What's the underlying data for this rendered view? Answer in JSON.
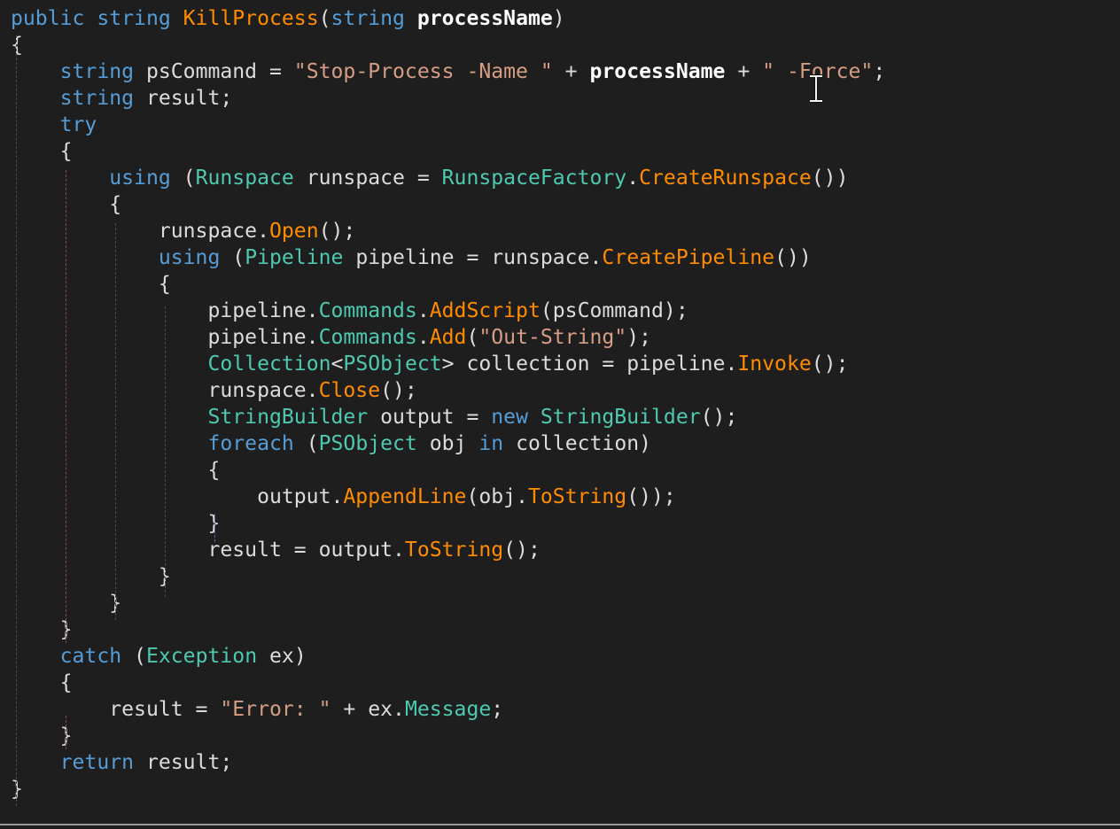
{
  "editor": {
    "language": "C#",
    "colors": {
      "background": "#1e1e1e",
      "keyword": "#569cd6",
      "type": "#4ec9b0",
      "method": "#ff8c00",
      "string": "#d69d85",
      "plain": "#dcdcdc"
    },
    "cursor_icon": "text-ibeam-cursor",
    "lines": [
      [
        [
          "kw",
          "public"
        ],
        [
          "pl",
          " "
        ],
        [
          "kw",
          "string"
        ],
        [
          "pl",
          " "
        ],
        [
          "fn",
          "KillProcess"
        ],
        [
          "pl",
          "("
        ],
        [
          "kw",
          "string"
        ],
        [
          "pl",
          " "
        ],
        [
          "bd",
          "processName"
        ],
        [
          "pl",
          ")"
        ]
      ],
      [
        [
          "pl",
          "{"
        ]
      ],
      [
        [
          "pl",
          "    "
        ],
        [
          "kw",
          "string"
        ],
        [
          "pl",
          " psCommand = "
        ],
        [
          "st",
          "\"Stop-Process -Name \""
        ],
        [
          "pl",
          " + "
        ],
        [
          "bd",
          "processName"
        ],
        [
          "pl",
          " + "
        ],
        [
          "st",
          "\" -Force\""
        ],
        [
          "pl",
          ";"
        ]
      ],
      [
        [
          "pl",
          "    "
        ],
        [
          "kw",
          "string"
        ],
        [
          "pl",
          " result;"
        ]
      ],
      [
        [
          "pl",
          "    "
        ],
        [
          "kw",
          "try"
        ]
      ],
      [
        [
          "pl",
          "    {"
        ]
      ],
      [
        [
          "pl",
          "        "
        ],
        [
          "kw",
          "using"
        ],
        [
          "pl",
          " ("
        ],
        [
          "ty",
          "Runspace"
        ],
        [
          "pl",
          " runspace = "
        ],
        [
          "ty",
          "RunspaceFactory"
        ],
        [
          "pl",
          "."
        ],
        [
          "fn",
          "CreateRunspace"
        ],
        [
          "pl",
          "())"
        ]
      ],
      [
        [
          "pl",
          "        {"
        ]
      ],
      [
        [
          "pl",
          "            runspace."
        ],
        [
          "fn",
          "Open"
        ],
        [
          "pl",
          "();"
        ]
      ],
      [
        [
          "pl",
          "            "
        ],
        [
          "kw",
          "using"
        ],
        [
          "pl",
          " ("
        ],
        [
          "ty",
          "Pipeline"
        ],
        [
          "pl",
          " pipeline = runspace."
        ],
        [
          "fn",
          "CreatePipeline"
        ],
        [
          "pl",
          "())"
        ]
      ],
      [
        [
          "pl",
          "            {"
        ]
      ],
      [
        [
          "pl",
          "                pipeline."
        ],
        [
          "ty",
          "Commands"
        ],
        [
          "pl",
          "."
        ],
        [
          "fn",
          "AddScript"
        ],
        [
          "pl",
          "(psCommand);"
        ]
      ],
      [
        [
          "pl",
          "                pipeline."
        ],
        [
          "ty",
          "Commands"
        ],
        [
          "pl",
          "."
        ],
        [
          "fn",
          "Add"
        ],
        [
          "pl",
          "("
        ],
        [
          "st",
          "\"Out-String\""
        ],
        [
          "pl",
          ");"
        ]
      ],
      [
        [
          "pl",
          "                "
        ],
        [
          "ty",
          "Collection"
        ],
        [
          "pl",
          "<"
        ],
        [
          "ty",
          "PSObject"
        ],
        [
          "pl",
          "> collection = pipeline."
        ],
        [
          "fn",
          "Invoke"
        ],
        [
          "pl",
          "();"
        ]
      ],
      [
        [
          "pl",
          "                runspace."
        ],
        [
          "fn",
          "Close"
        ],
        [
          "pl",
          "();"
        ]
      ],
      [
        [
          "pl",
          "                "
        ],
        [
          "ty",
          "StringBuilder"
        ],
        [
          "pl",
          " output = "
        ],
        [
          "kw",
          "new"
        ],
        [
          "pl",
          " "
        ],
        [
          "ty",
          "StringBuilder"
        ],
        [
          "pl",
          "();"
        ]
      ],
      [
        [
          "pl",
          "                "
        ],
        [
          "kw",
          "foreach"
        ],
        [
          "pl",
          " ("
        ],
        [
          "ty",
          "PSObject"
        ],
        [
          "pl",
          " obj "
        ],
        [
          "kw",
          "in"
        ],
        [
          "pl",
          " collection)"
        ]
      ],
      [
        [
          "pl",
          "                {"
        ]
      ],
      [
        [
          "pl",
          "                    output."
        ],
        [
          "fn",
          "AppendLine"
        ],
        [
          "pl",
          "(obj."
        ],
        [
          "fn",
          "ToString"
        ],
        [
          "pl",
          "());"
        ]
      ],
      [
        [
          "pl",
          "                }"
        ]
      ],
      [
        [
          "pl",
          "                result = output."
        ],
        [
          "fn",
          "ToString"
        ],
        [
          "pl",
          "();"
        ]
      ],
      [
        [
          "pl",
          "            }"
        ]
      ],
      [
        [
          "pl",
          "        }"
        ]
      ],
      [
        [
          "pl",
          "    }"
        ]
      ],
      [
        [
          "pl",
          "    "
        ],
        [
          "kw",
          "catch"
        ],
        [
          "pl",
          " ("
        ],
        [
          "ty",
          "Exception"
        ],
        [
          "pl",
          " ex)"
        ]
      ],
      [
        [
          "pl",
          "    {"
        ]
      ],
      [
        [
          "pl",
          "        result = "
        ],
        [
          "st",
          "\"Error: \""
        ],
        [
          "pl",
          " + ex."
        ],
        [
          "ty",
          "Message"
        ],
        [
          "pl",
          ";"
        ]
      ],
      [
        [
          "pl",
          "    }"
        ]
      ],
      [
        [
          "pl",
          "    "
        ],
        [
          "kw",
          "return"
        ],
        [
          "pl",
          " result;"
        ]
      ],
      [
        [
          "pl",
          "}"
        ]
      ]
    ]
  }
}
